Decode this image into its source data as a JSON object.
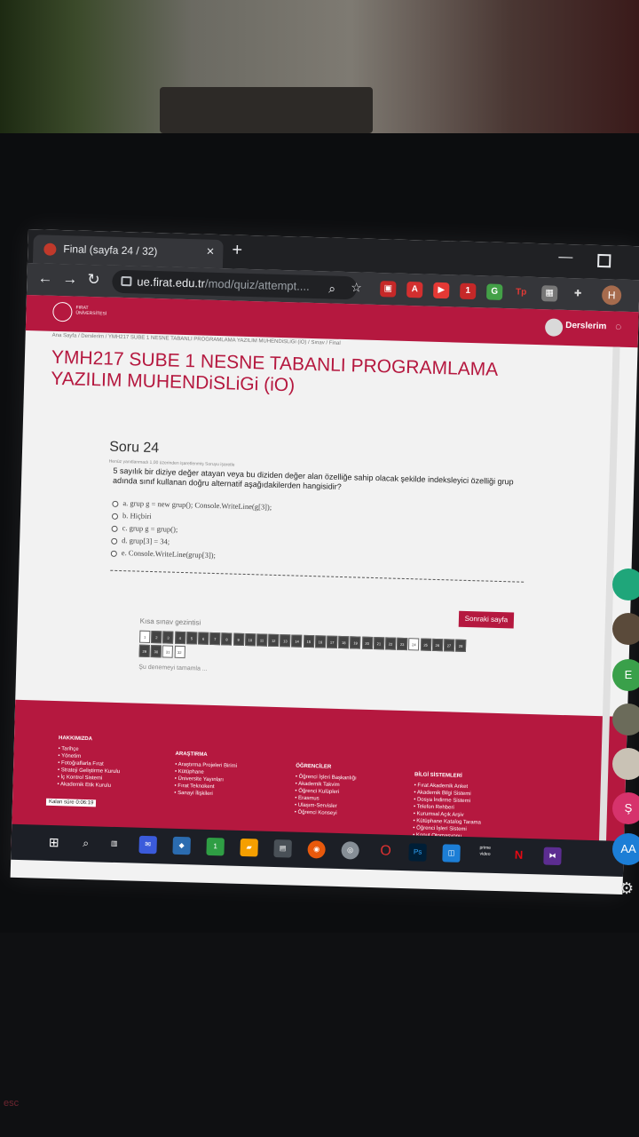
{
  "browser": {
    "tab_title": "Final (sayfa 24 / 32)",
    "tab_close": "×",
    "new_tab": "+",
    "url_host": "ue.firat.edu.tr",
    "url_path": "/mod/quiz/attempt....",
    "avatar_initial": "H",
    "ext_badge_1": "1"
  },
  "site": {
    "logo_text": "FIRAT ÜNİVERSİTESİ",
    "derslerim": "Derslerim",
    "breadcrumb": "Ana Sayfa / Derslerim / YMH217 SUBE 1 NESNE TABANLI PROGRAMLAMA YAZILIM MUHENDiSLiGi (iO) / Sınav / Final",
    "course_title": "YMH217 SUBE 1 NESNE TABANLI PROGRAMLAMA YAZILIM MUHENDiSLiGi (iO)"
  },
  "question": {
    "heading": "Soru 24",
    "meta": "Henüz yanıtlanmadı    1,00 üzerinden işaretlenmiş    Soruyu işaretle",
    "text": "5 sayılık bir diziye değer atayan veya bu diziden değer alan özelliğe sahip olacak şekilde indeksleyici özelliği grup adında sınıf kullanan doğru alternatif aşağıdakilerden hangisidir?",
    "answers": [
      "a. grup g = new grup(); Console.WriteLine(g[3]);",
      "b. Hiçbiri",
      "c. grup g = grup();",
      "d. grup[3] = 34;",
      "e. Console.WriteLine(grup[3]);"
    ]
  },
  "quiz_nav": {
    "next_button": "Sonraki sayfa",
    "title": "Kısa sınav gezintisi",
    "buttons": [
      "1",
      "2",
      "3",
      "4",
      "5",
      "6",
      "7",
      "8",
      "9",
      "10",
      "11",
      "12",
      "13",
      "14",
      "15",
      "16",
      "17",
      "18",
      "19",
      "20",
      "21",
      "22",
      "23",
      "24",
      "25",
      "26",
      "27",
      "28",
      "29",
      "30",
      "31",
      "32"
    ],
    "finish_link": "Şu denemeyi tamamla ..."
  },
  "footer": {
    "col1_title": "HAKKIMIZDA",
    "col1_items": [
      "Tarihçe",
      "Yönetim",
      "Fotoğraflarla Fırat",
      "Strateji Geliştirme Kurulu",
      "İç Kontrol Sistemi",
      "Akademik Etik Kurulu"
    ],
    "col2_title": "ARAŞTIRMA",
    "col2_items": [
      "Araştırma Projeleri Birimi",
      "Kütüphane",
      "Üniversite Yayınları",
      "Fırat Teknokent",
      "Sanayi İlişkileri"
    ],
    "col3_title": "ÖĞRENCİLER",
    "col3_items": [
      "Öğrenci İşleri Başkanlığı",
      "Akademik Takvim",
      "Öğrenci Kulüpleri",
      "Erasmus",
      "Ulaşım-Servisler",
      "Öğrenci Konseyi"
    ],
    "col4_title": "BİLGİ SİSTEMLERİ",
    "col4_items": [
      "Fırat Akademik Anket",
      "Akademik Bilgi Sistemi",
      "Dosya İndirme Sistemi",
      "Telefon Rehberi",
      "Kurumsal Açık Arşiv",
      "Kütüphane Katalog Tarama",
      "Öğrenci İşleri Sistemi",
      "Konut Otomasyonu"
    ],
    "timer_label": "Kalan süre 0:06:19"
  },
  "taskbar": {
    "chrome_badge": "1",
    "ps_label": "Ps",
    "prime_label": "prime video",
    "n_label": "N"
  },
  "side_bubbles": [
    "E",
    "Ş",
    "AA"
  ],
  "keyboard_label": "esc"
}
